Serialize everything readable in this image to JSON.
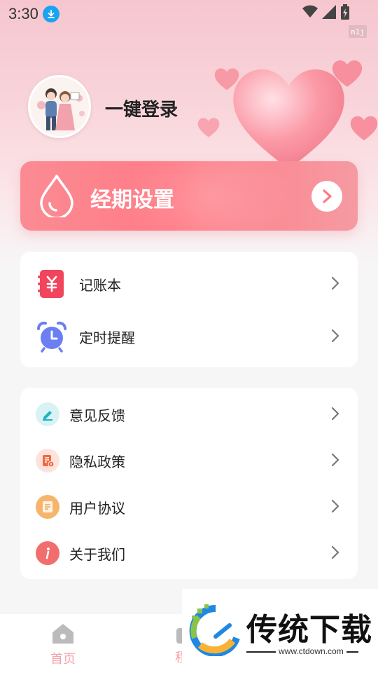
{
  "status_bar": {
    "time": "3:30",
    "watermark_tag": "n1j"
  },
  "profile": {
    "login_text": "一键登录"
  },
  "period_card": {
    "label": "经期设置"
  },
  "tools": {
    "items": [
      {
        "label": "记账本",
        "icon": "ledger-icon"
      },
      {
        "label": "定时提醒",
        "icon": "alarm-clock-icon"
      }
    ]
  },
  "settings": {
    "items": [
      {
        "label": "意见反馈",
        "icon": "pencil-icon"
      },
      {
        "label": "隐私政策",
        "icon": "privacy-doc-icon"
      },
      {
        "label": "用户协议",
        "icon": "agreement-doc-icon"
      },
      {
        "label": "关于我们",
        "icon": "info-icon"
      }
    ]
  },
  "bottom_nav": {
    "home_label": "首页",
    "second_label_partial": "程"
  },
  "watermark": {
    "title": "传统下载",
    "url": "www.ctdown.com"
  },
  "colors": {
    "accent_pink": "#ff7b86",
    "ledger_red": "#f0455c",
    "alarm_blue": "#6b7ff2",
    "nav_pink": "#f4a2ad"
  }
}
